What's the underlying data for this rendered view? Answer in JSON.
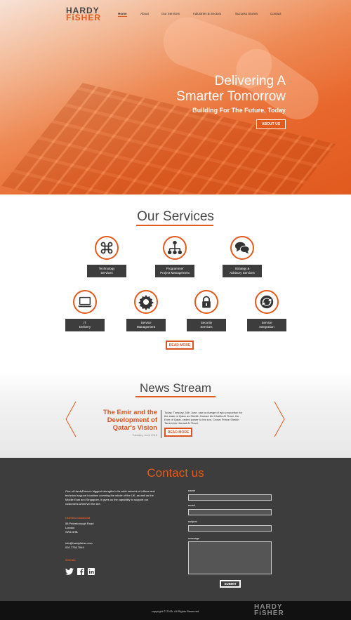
{
  "logo": {
    "line1": "HARDY",
    "line2": "FiSHER"
  },
  "nav": {
    "items": [
      "Home",
      "About",
      "Our Services",
      "Industries & Sectors",
      "Success Stories",
      "Contact"
    ],
    "active": "Home"
  },
  "hero": {
    "title_line1": "Delivering A",
    "title_line2": "Smarter Tomorrow",
    "subtitle": "Building For The Future, Today",
    "button": "ABOUT US"
  },
  "services": {
    "title": "Our Services",
    "items": [
      {
        "line1": "Technology",
        "line2": "Services",
        "icon": "command-icon"
      },
      {
        "line1": "Programme/",
        "line2": "Project Management",
        "icon": "hierarchy-icon"
      },
      {
        "line1": "Strategy &",
        "line2": "Advisory Services",
        "icon": "chat-bubbles-icon"
      },
      {
        "line1": "IT",
        "line2": "Delivery",
        "icon": "laptop-icon"
      },
      {
        "line1": "Service",
        "line2": "Management",
        "icon": "gear-icon"
      },
      {
        "line1": "Security",
        "line2": "Services",
        "icon": "lock-icon"
      },
      {
        "line1": "Service",
        "line2": "Integration",
        "icon": "refresh-icon"
      }
    ],
    "button": "READ MORE"
  },
  "news": {
    "title": "News Stream",
    "headline_1": "The Emir and the",
    "headline_2": "Development of",
    "headline_3": "Qatar's Vision",
    "date": "Tuesday, June 2015",
    "excerpt": "Today, Tuesday 24th June, saw a change of epic proportion for the state of Qatar as Sheikh Hamad bin Khalifa Al Thani, the Emir of Qatar, ceded power to his son, Crown Prince Sheikh Tamim bin Hamad Al Thani.",
    "button": "READ MORE"
  },
  "contact": {
    "title": "Contact us",
    "intro": "One of HardyFisher's biggest strengths is its wide network of offices and technical support locations covering the whole of the UK, as well as the Middle East and Singapore, it gives us the capability to support our customers wherever the are.",
    "office_heading": "UNITED KINGDOM",
    "address_1": "58 Peterborough Road",
    "address_2": "London",
    "address_3": "SW6 3HB",
    "email": "info@hardyfisher.com",
    "phone": "020 7736 7949",
    "social_heading": "SOCIAL",
    "form": {
      "name": "name",
      "email": "email",
      "subject": "subject",
      "message": "message",
      "submit": "SUBMIT"
    }
  },
  "footer": {
    "copyright": "copyright © 2015. All Rights Reserved.",
    "logo_line1": "HARDY",
    "logo_line2": "FiSHER"
  },
  "colors": {
    "accent": "#e25a1c",
    "dark": "#3d3d3d",
    "footer": "#111111"
  }
}
